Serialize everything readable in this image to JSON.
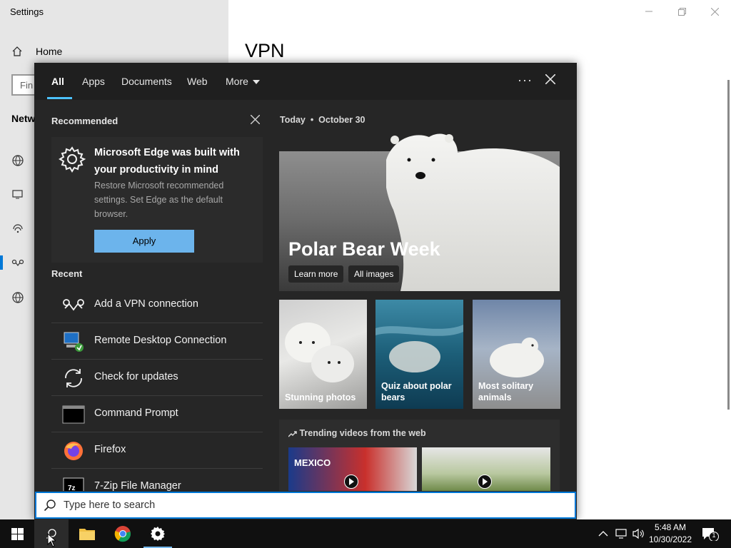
{
  "settings": {
    "title": "Settings",
    "home_label": "Home",
    "find_placeholder": "Fin",
    "section_label": "Netw",
    "page_heading": "VPN"
  },
  "tabs": [
    "All",
    "Apps",
    "Documents",
    "Web",
    "More"
  ],
  "recommended": {
    "header": "Recommended",
    "title": "Microsoft Edge was built with your productivity in mind",
    "description": "Restore Microsoft recommended settings. Set Edge as the default browser.",
    "apply_label": "Apply"
  },
  "recent": {
    "header": "Recent",
    "items": [
      {
        "label": "Add a VPN connection",
        "icon": "vpn-icon"
      },
      {
        "label": "Remote Desktop Connection",
        "icon": "remote-desktop-icon"
      },
      {
        "label": "Check for updates",
        "icon": "refresh-icon"
      },
      {
        "label": "Command Prompt",
        "icon": "command-prompt-icon"
      },
      {
        "label": "Firefox",
        "icon": "firefox-icon"
      },
      {
        "label": "7-Zip File Manager",
        "icon": "seven-zip-icon"
      }
    ]
  },
  "today": {
    "label": "Today",
    "date": "October 30"
  },
  "hero": {
    "title": "Polar Bear Week",
    "learn_more": "Learn more",
    "all_images": "All images"
  },
  "tiles": [
    {
      "label": "Stunning photos"
    },
    {
      "label": "Quiz about polar bears"
    },
    {
      "label": "Most solitary animals"
    }
  ],
  "trending": {
    "title": "Trending videos from the web",
    "video1_text": "MEXICO"
  },
  "search": {
    "placeholder": "Type here to search"
  },
  "clock": {
    "time": "5:48 AM",
    "date": "10/30/2022"
  },
  "notifications": {
    "count": "1"
  },
  "colors": {
    "accent": "#0078d7",
    "apply_button": "#6cb4ec",
    "panel_bg": "#262626"
  }
}
